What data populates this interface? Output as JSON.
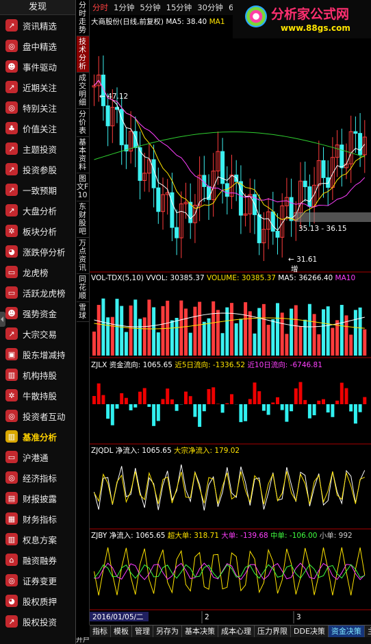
{
  "sidebar": {
    "header": "发现",
    "items": [
      {
        "label": "资讯精选",
        "icon": "chart-line-icon"
      },
      {
        "label": "盘中精选",
        "icon": "target-icon"
      },
      {
        "label": "事件驱动",
        "icon": "person-icon"
      },
      {
        "label": "近期关注",
        "icon": "chart-line-icon"
      },
      {
        "label": "特别关注",
        "icon": "target-icon"
      },
      {
        "label": "价值关注",
        "icon": "tree-icon"
      },
      {
        "label": "主题投资",
        "icon": "chart-line-icon"
      },
      {
        "label": "投资参股",
        "icon": "chart-line-icon"
      },
      {
        "label": "一致预期",
        "icon": "chart-line-icon"
      },
      {
        "label": "大盘分析",
        "icon": "chart-line-icon"
      },
      {
        "label": "板块分析",
        "icon": "gear-icon"
      },
      {
        "label": "涨跌停分析",
        "icon": "piggy-bank-icon"
      },
      {
        "label": "龙虎榜",
        "icon": "card-icon"
      },
      {
        "label": "活跃龙虎榜",
        "icon": "card-icon"
      },
      {
        "label": "强势资金",
        "icon": "person-icon"
      },
      {
        "label": "大宗交易",
        "icon": "chart-line-icon"
      },
      {
        "label": "股东增减持",
        "icon": "briefcase-icon"
      },
      {
        "label": "机构持股",
        "icon": "bar-chart-icon"
      },
      {
        "label": "牛散持股",
        "icon": "gear-icon"
      },
      {
        "label": "投资者互动",
        "icon": "target-icon"
      },
      {
        "label": "基准分析",
        "icon": "bar-chart-icon",
        "active": true
      },
      {
        "label": "沪港通",
        "icon": "card-icon"
      },
      {
        "label": "经济指标",
        "icon": "target-icon"
      },
      {
        "label": "财报披露",
        "icon": "document-icon"
      },
      {
        "label": "财务指标",
        "icon": "clipboard-icon"
      },
      {
        "label": "权息方案",
        "icon": "bar-chart-icon"
      },
      {
        "label": "融资融券",
        "icon": "bank-icon"
      },
      {
        "label": "证券变更",
        "icon": "target-icon"
      },
      {
        "label": "股权质押",
        "icon": "piggy-bank-icon"
      },
      {
        "label": "股权投资",
        "icon": "chart-line-icon"
      }
    ]
  },
  "vtabs": [
    {
      "label": "分时走势"
    },
    {
      "label": "技术分析",
      "active": true
    },
    {
      "label": "成交明细"
    },
    {
      "label": "分价表"
    },
    {
      "label": "基本资料"
    },
    {
      "label": "图文F10"
    },
    {
      "label": "东财股吧"
    },
    {
      "label": "万点资讯"
    },
    {
      "label": "同花顺"
    },
    {
      "label": "雪球"
    }
  ],
  "periods": [
    {
      "label": "分时",
      "selected": true
    },
    {
      "label": "1分钟"
    },
    {
      "label": "5分钟"
    },
    {
      "label": "15分钟"
    },
    {
      "label": "30分钟"
    },
    {
      "label": "6"
    }
  ],
  "logo": {
    "title": "分析家公式网",
    "url_text": "www.88gs.com"
  },
  "price_panel": {
    "title": "大商股份(日线,前复权)",
    "ma5_label": "MA5: 38.40",
    "ma_trunc": "MA1",
    "high_label": "47.12",
    "low_label": "31.61",
    "range_label": "35.13 - 36.15",
    "increase_marker": "增"
  },
  "vol_panel": {
    "name": "VOL-TDX(5,10)",
    "vvol": "VVOL: 30385.37",
    "volume": "VOLUME: 30385.37",
    "ma5": "MA5: 36266.40",
    "ma_trunc": "MA10"
  },
  "zjlx_panel": {
    "name": "ZJLX",
    "flow": "资金流向: 1065.65",
    "flow5": "近5日流向: -1336.52",
    "flow10": "近10日流向: -6746.81"
  },
  "zjqdl_panel": {
    "name": "ZJQDL",
    "net": "净流入: 1065.65",
    "block": "大宗净流入: 179.02"
  },
  "zjby_panel": {
    "name": "ZJBY",
    "net": "净流入: 1065.65",
    "super": "超大单: 318.71",
    "big": "大单: -139.68",
    "mid": "中单: -106.00",
    "small": "小单: 992"
  },
  "date_label": "2016/01/05/二",
  "month_markers": [
    "2",
    "3"
  ],
  "bottom_tabs": [
    {
      "label": "指标"
    },
    {
      "label": "模板"
    },
    {
      "label": "管理"
    },
    {
      "label": "另存为"
    },
    {
      "label": "基本决策"
    },
    {
      "label": "成本心理"
    },
    {
      "label": "压力界限"
    },
    {
      "label": "DDE决策"
    },
    {
      "label": "资金决策",
      "active": true
    },
    {
      "label": "主"
    }
  ],
  "bottom2_items": [
    "开户"
  ]
}
